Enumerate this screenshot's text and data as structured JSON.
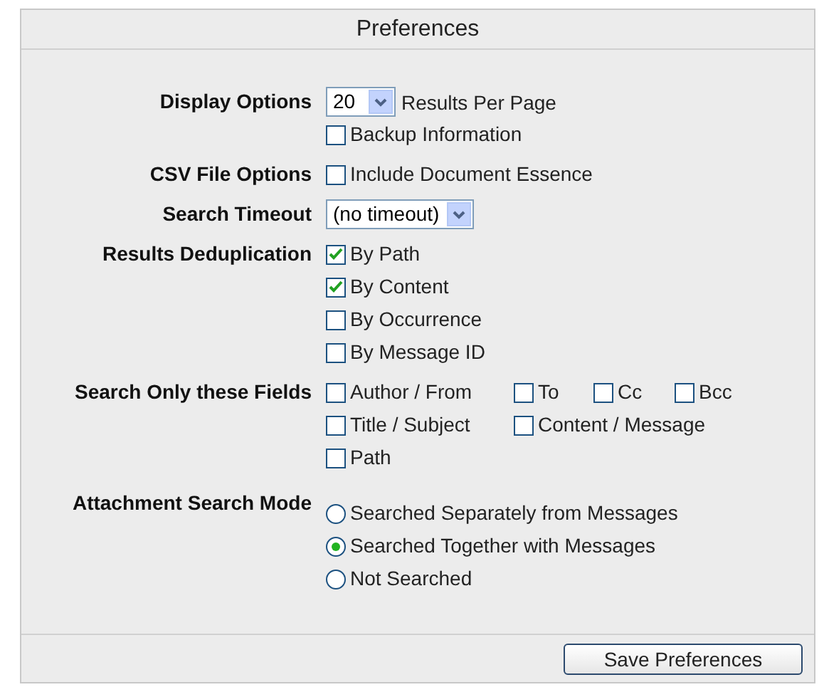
{
  "title": "Preferences",
  "sections": [
    {
      "label": "Display Options",
      "kind": "list",
      "rows": [
        [
          {
            "kind": "select",
            "value": "20"
          },
          {
            "kind": "text",
            "text": "Results Per Page"
          }
        ],
        [
          {
            "kind": "checkbox",
            "label": "Backup Information",
            "checked": false
          }
        ]
      ]
    },
    {
      "label": "CSV File Options",
      "kind": "list",
      "rows": [
        [
          {
            "kind": "checkbox",
            "label": "Include Document Essence",
            "checked": false
          }
        ]
      ]
    },
    {
      "label": "Search Timeout",
      "kind": "list",
      "rows": [
        [
          {
            "kind": "select",
            "value": "(no timeout)"
          }
        ]
      ]
    },
    {
      "label": "Results Deduplication",
      "kind": "list",
      "rows": [
        [
          {
            "kind": "checkbox",
            "label": "By Path",
            "checked": true
          }
        ],
        [
          {
            "kind": "checkbox",
            "label": "By Content",
            "checked": true
          }
        ],
        [
          {
            "kind": "checkbox",
            "label": "By Occurrence",
            "checked": false
          }
        ],
        [
          {
            "kind": "checkbox",
            "label": "By Message ID",
            "checked": false
          }
        ]
      ]
    },
    {
      "label": "Search Only these Fields",
      "kind": "grid",
      "rows": [
        [
          {
            "kind": "checkbox",
            "label": "Author / From",
            "checked": false
          },
          {
            "kind": "checkbox",
            "label": "To",
            "checked": false
          },
          {
            "kind": "checkbox",
            "label": "Cc",
            "checked": false
          },
          {
            "kind": "checkbox",
            "label": "Bcc",
            "checked": false
          }
        ],
        [
          {
            "kind": "checkbox",
            "label": "Title / Subject",
            "checked": false
          },
          {
            "kind": "checkbox",
            "label": "Content / Message",
            "checked": false
          }
        ],
        [
          {
            "kind": "checkbox",
            "label": "Path",
            "checked": false
          }
        ]
      ]
    },
    {
      "label": "Attachment Search Mode",
      "kind": "list",
      "rows": [
        [
          {
            "kind": "radio",
            "label": "Searched Separately from Messages",
            "selected": false
          }
        ],
        [
          {
            "kind": "radio",
            "label": "Searched Together with Messages",
            "selected": true
          }
        ],
        [
          {
            "kind": "radio",
            "label": "Not Searched",
            "selected": false
          }
        ]
      ]
    }
  ],
  "save_button": "Save Preferences"
}
